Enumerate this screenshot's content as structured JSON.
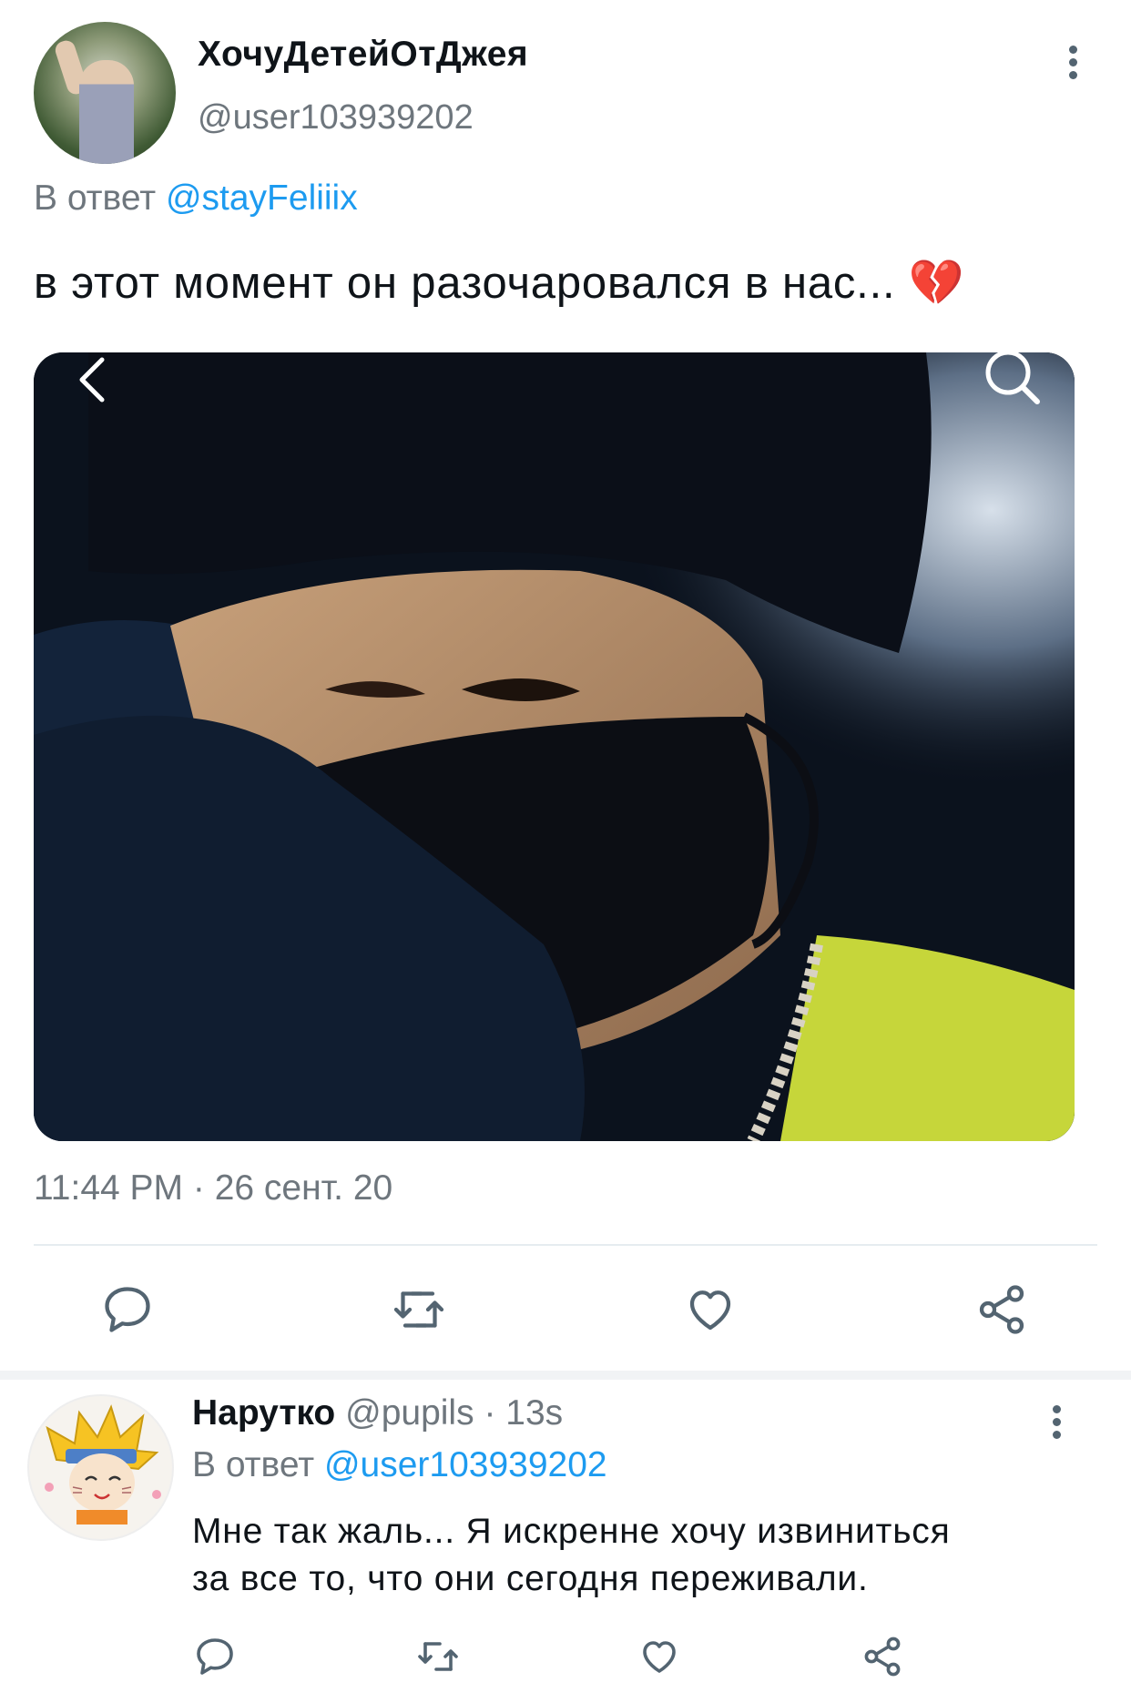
{
  "tweet": {
    "display_name": "ХочуДетейОтДжея",
    "handle": "@user103939202",
    "reply_prefix": "В ответ",
    "reply_to": "@stayFeliiix",
    "text": "в этот момент он разочаровался в нас... ",
    "emoji": "💔",
    "timestamp": "11:44 PM · 26 сент. 20"
  },
  "reply": {
    "display_name": "Нарутко",
    "handle": "@pupils",
    "separator": "·",
    "time": "13s",
    "reply_prefix": "В ответ",
    "reply_to": "@user103939202",
    "text_line1": "Мне так жаль... Я искренне хочу извиниться",
    "text_line2": "за все то, что они сегодня переживали."
  },
  "colors": {
    "link": "#1d9bf0",
    "muted": "#6e767d",
    "icon": "#536471"
  },
  "icons": [
    "more-icon",
    "back-arrow-icon",
    "search-icon",
    "reply-icon",
    "retweet-icon",
    "like-icon",
    "share-icon"
  ]
}
